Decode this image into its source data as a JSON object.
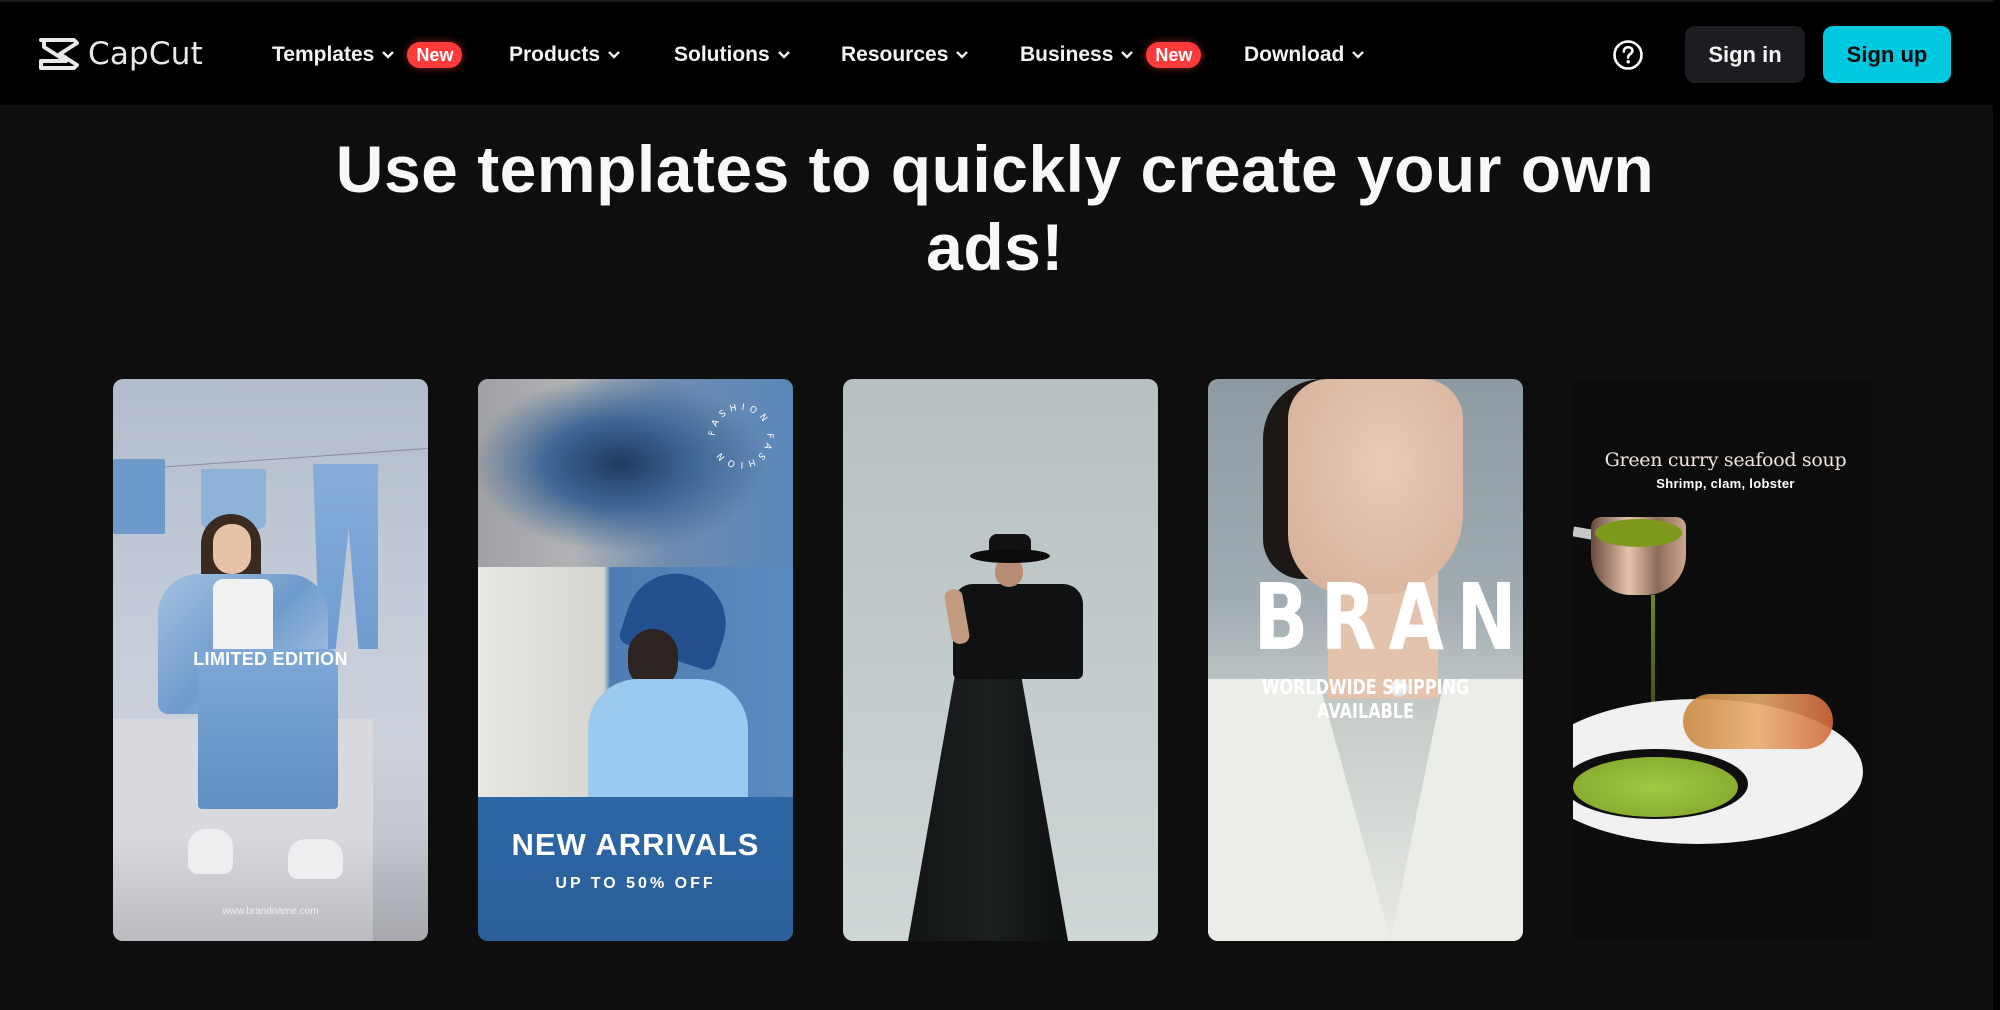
{
  "header": {
    "logo_text": "CapCut",
    "nav": [
      {
        "label": "Templates",
        "has_dropdown": true,
        "badge": "New"
      },
      {
        "label": "Products",
        "has_dropdown": true,
        "badge": null
      },
      {
        "label": "Solutions",
        "has_dropdown": true,
        "badge": null
      },
      {
        "label": "Resources",
        "has_dropdown": true,
        "badge": null
      },
      {
        "label": "Business",
        "has_dropdown": true,
        "badge": "New"
      },
      {
        "label": "Download",
        "has_dropdown": true,
        "badge": null
      }
    ],
    "help_icon": "question-circle-icon",
    "signin_label": "Sign in",
    "signup_label": "Sign up"
  },
  "hero": {
    "title": "Use templates to quickly create your own ads!"
  },
  "templates": [
    {
      "theme": "denim-fashion",
      "headline": "LIMITED EDITION",
      "footer": "www.brandname.com"
    },
    {
      "theme": "new-arrivals",
      "ring_text": "FASHION FASHION",
      "headline": "NEW ARRIVALS",
      "subline": "UP TO 50% OFF"
    },
    {
      "theme": "black-dress-fashion"
    },
    {
      "theme": "jewelry-brand",
      "headline": "BRAND",
      "subline": "WORLDWIDE SHIPPING AVAILABLE"
    },
    {
      "theme": "food-soup",
      "headline": "Green curry seafood soup",
      "subline": "Shrimp, clam, lobster"
    }
  ],
  "colors": {
    "background": "#0e0e0e",
    "header": "#000000",
    "accent": "#00c8e0",
    "badge": "#fe3b3b",
    "signin_bg": "#1c1d20"
  }
}
